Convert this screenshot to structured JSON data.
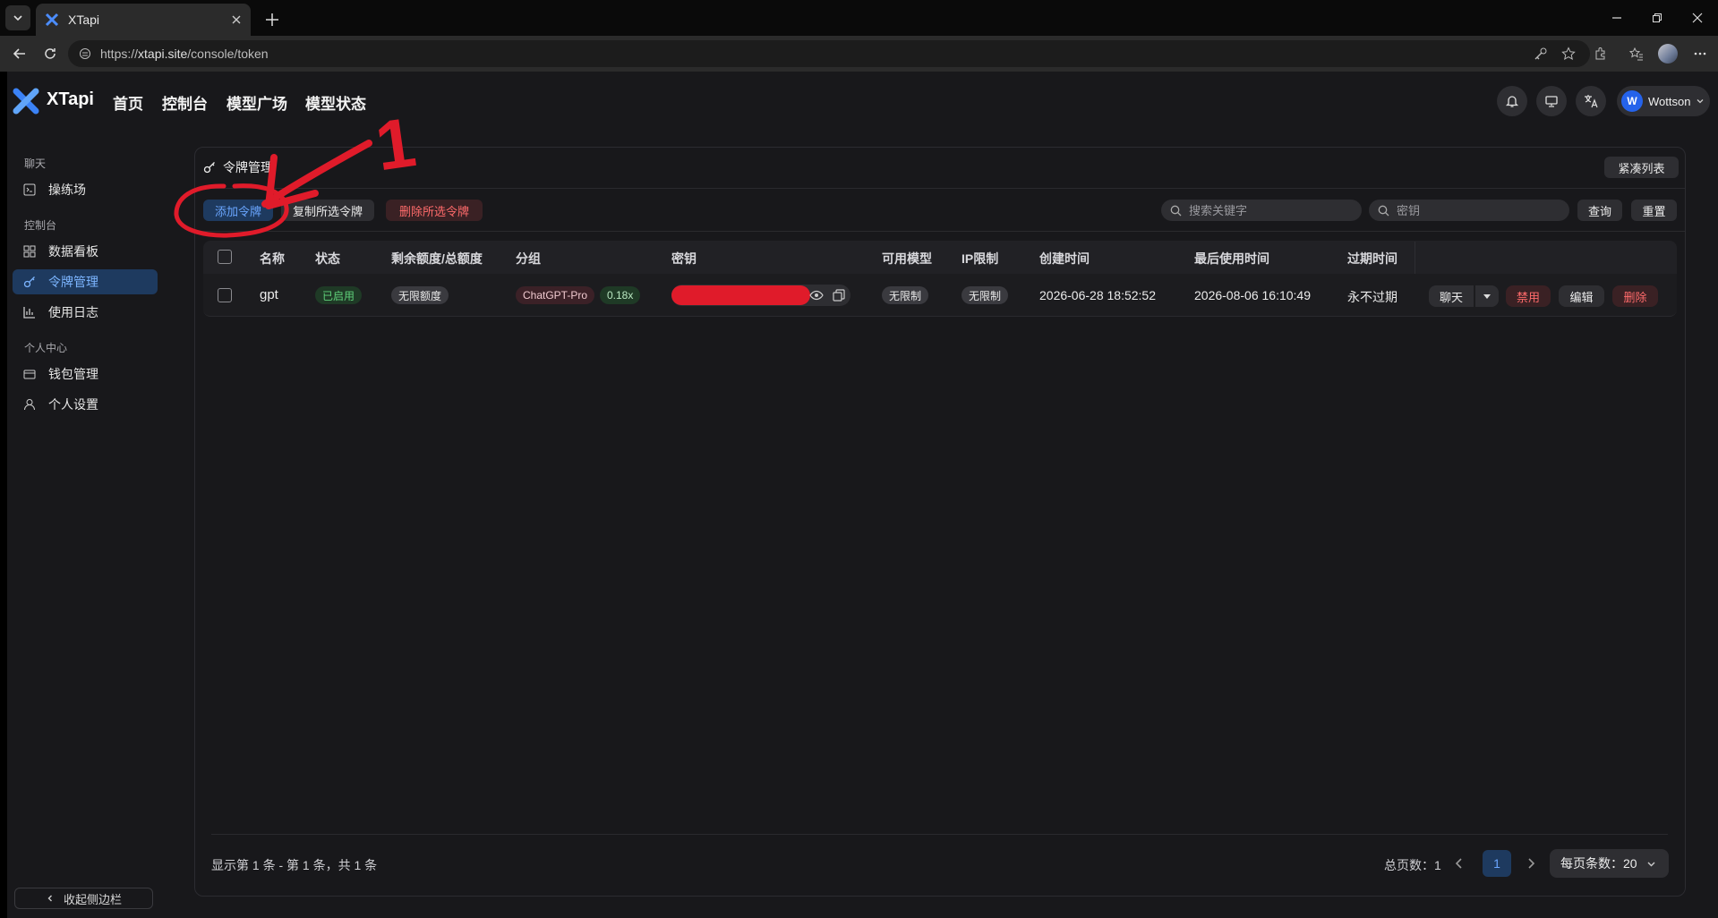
{
  "browser": {
    "tab_title": "XTapi",
    "url_host": "xtapi.site",
    "url_full_prefix": "https://",
    "url_path": "/console/token"
  },
  "header": {
    "brand": "XTapi",
    "nav": [
      "首页",
      "控制台",
      "模型广场",
      "模型状态"
    ],
    "user_initial": "W",
    "user_name": "Wottson"
  },
  "sidebar": {
    "sections": [
      {
        "title": "聊天",
        "items": [
          {
            "label": "操练场",
            "icon": "playground-icon"
          }
        ]
      },
      {
        "title": "控制台",
        "items": [
          {
            "label": "数据看板",
            "icon": "dashboard-icon"
          },
          {
            "label": "令牌管理",
            "icon": "key-icon",
            "active": true
          },
          {
            "label": "使用日志",
            "icon": "chart-icon"
          }
        ]
      },
      {
        "title": "个人中心",
        "items": [
          {
            "label": "钱包管理",
            "icon": "wallet-icon"
          },
          {
            "label": "个人设置",
            "icon": "user-icon"
          }
        ]
      }
    ],
    "collapse_label": "收起侧边栏"
  },
  "card": {
    "title": "令牌管理",
    "compact_label": "紧凑列表",
    "toolbar": {
      "add": "添加令牌",
      "copy": "复制所选令牌",
      "delete": "删除所选令牌",
      "search_placeholder": "搜索关键字",
      "key_placeholder": "密钥",
      "query": "查询",
      "reset": "重置"
    }
  },
  "table": {
    "columns": [
      "名称",
      "状态",
      "剩余额度/总额度",
      "分组",
      "密钥",
      "可用模型",
      "IP限制",
      "创建时间",
      "最后使用时间",
      "过期时间"
    ],
    "rows": [
      {
        "name": "gpt",
        "status": "已启用",
        "quota": "无限额度",
        "group": "ChatGPT-Pro",
        "ratio": "0.18x",
        "models": "无限制",
        "ip": "无限制",
        "created": "2026-06-28 18:52:52",
        "last_used": "2026-08-06 16:10:49",
        "expires": "永不过期",
        "actions": {
          "chat": "聊天",
          "disable": "禁用",
          "edit": "编辑",
          "delete": "删除"
        }
      }
    ]
  },
  "pagination": {
    "summary": "显示第 1 条 - 第 1 条，共 1 条",
    "total_pages": "总页数：1",
    "current": "1",
    "page_size": "每页条数：20"
  },
  "annotation": {
    "number": "1",
    "color": "#e01b2a"
  },
  "colors": {
    "accent": "#6aa6ff",
    "danger": "#ff5a5a",
    "success": "#5fd07a"
  }
}
